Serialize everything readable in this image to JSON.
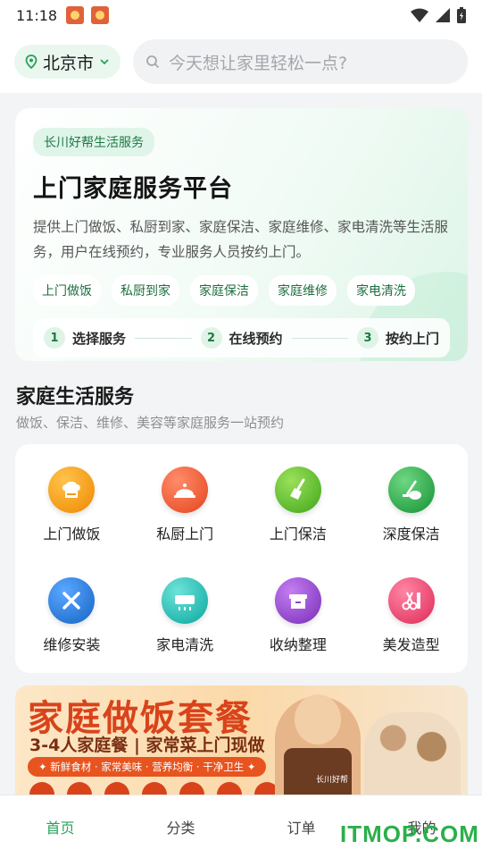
{
  "status_bar": {
    "time": "11:18"
  },
  "location": {
    "city": "北京市"
  },
  "search": {
    "placeholder": "今天想让家里轻松一点?"
  },
  "hero": {
    "badge": "长川好帮生活服务",
    "title": "上门家庭服务平台",
    "description": "提供上门做饭、私厨到家、家庭保洁、家庭维修、家电清洗等生活服务，用户在线预约，专业服务人员按约上门。",
    "tags": [
      "上门做饭",
      "私厨到家",
      "家庭保洁",
      "家庭维修",
      "家电清洗"
    ],
    "steps": [
      {
        "num": "1",
        "label": "选择服务"
      },
      {
        "num": "2",
        "label": "在线预约"
      },
      {
        "num": "3",
        "label": "按约上门"
      }
    ]
  },
  "services_section": {
    "title": "家庭生活服务",
    "subtitle": "做饭、保洁、维修、美容等家庭服务一站预约",
    "items": [
      {
        "label": "上门做饭",
        "icon": "chef-hat-icon",
        "color": "#f39a16"
      },
      {
        "label": "私厨上门",
        "icon": "cloche-icon",
        "color": "#ec5a34"
      },
      {
        "label": "上门保洁",
        "icon": "broom-icon",
        "color": "#5ab82d"
      },
      {
        "label": "深度保洁",
        "icon": "vacuum-icon",
        "color": "#2fa64b"
      },
      {
        "label": "维修安装",
        "icon": "tools-icon",
        "color": "#2a78d6"
      },
      {
        "label": "家电清洗",
        "icon": "air-conditioner-icon",
        "color": "#27b9b0"
      },
      {
        "label": "收纳整理",
        "icon": "storage-box-icon",
        "color": "#8e45c9"
      },
      {
        "label": "美发造型",
        "icon": "scissors-comb-icon",
        "color": "#e8456e"
      }
    ]
  },
  "banner": {
    "title": "家庭做饭套餐",
    "subtitle": "3-4人家庭餐 | 家常菜上门现做",
    "strip": "✦ 新鲜食材 · 家常美味 · 营养均衡 · 干净卫生 ✦",
    "apron_text": "长川好帮"
  },
  "tabbar": {
    "items": [
      "首页",
      "分类",
      "订单",
      "我的"
    ],
    "active_color": "#2aa15a"
  },
  "watermark": "ITMOP.COM",
  "colors": {
    "brand_green": "#2aa15a",
    "banner_red": "#d9431b"
  }
}
